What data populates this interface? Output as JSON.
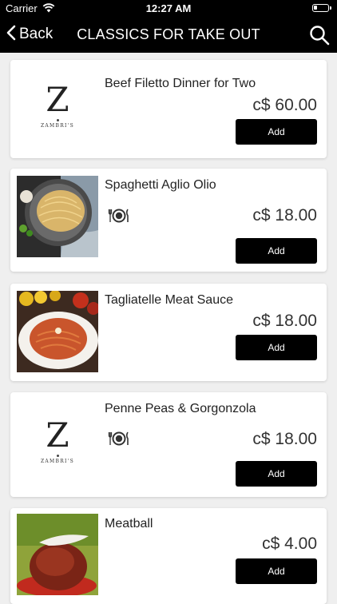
{
  "status_bar": {
    "carrier": "Carrier",
    "time": "12:27 AM",
    "battery_level": 0.25
  },
  "nav": {
    "back_label": "Back",
    "title": "CLASSICS FOR TAKE OUT"
  },
  "items": [
    {
      "name": "Beef Filetto Dinner for Two",
      "price": "c$ 60.00",
      "add_label": "Add",
      "image": "zambris-logo",
      "dine_icon": false
    },
    {
      "name": "Spaghetti Aglio Olio",
      "price": "c$ 18.00",
      "add_label": "Add",
      "image": "spaghetti-photo",
      "dine_icon": true
    },
    {
      "name": "Tagliatelle Meat Sauce",
      "price": "c$ 18.00",
      "add_label": "Add",
      "image": "tagliatelle-photo",
      "dine_icon": false
    },
    {
      "name": "Penne Peas & Gorgonzola",
      "price": "c$ 18.00",
      "add_label": "Add",
      "image": "zambris-logo",
      "dine_icon": true
    },
    {
      "name": "Meatball",
      "price": "c$ 4.00",
      "add_label": "Add",
      "image": "meatball-photo",
      "dine_icon": false
    }
  ],
  "logo": {
    "letter": "Z",
    "wordmark": "ZAMBRI'S"
  },
  "colors": {
    "nav_background": "#000000",
    "page_background": "#efefef",
    "card_background": "#ffffff",
    "button_background": "#000000",
    "button_text": "#ffffff"
  },
  "icons": {
    "back": "chevron-left-icon",
    "search": "search-icon",
    "dine_in": "plate-cutlery-icon"
  }
}
